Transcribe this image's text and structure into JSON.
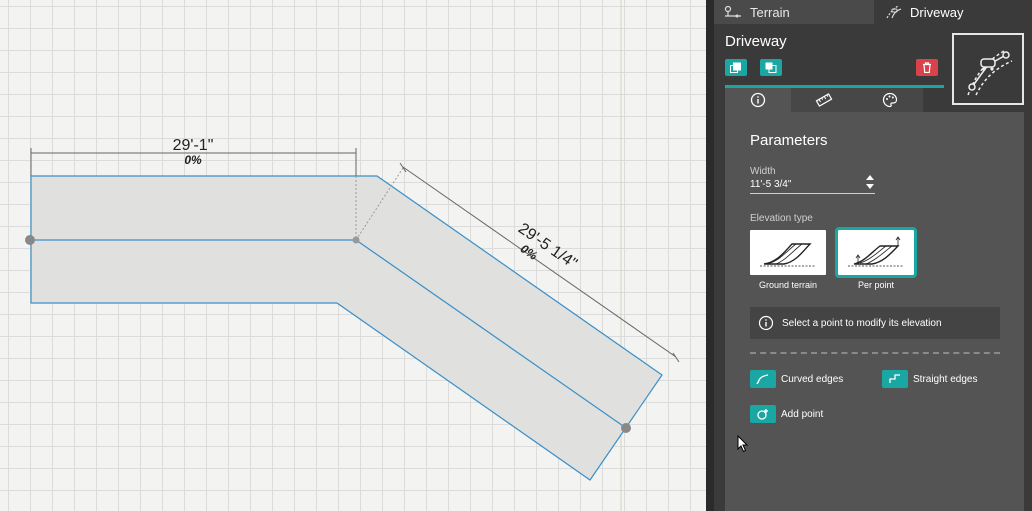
{
  "canvas": {
    "segment1": {
      "length": "29'-1\"",
      "slope": "0%"
    },
    "segment2": {
      "length": "29'-5 1/4\"",
      "slope": "0%"
    }
  },
  "tabs": {
    "terrain": {
      "label": "Terrain",
      "icon": "terrain-icon"
    },
    "driveway": {
      "label": "Driveway",
      "icon": "driveway-icon"
    }
  },
  "panel": {
    "title": "Driveway",
    "buttons": {
      "bring_front": "bring-to-front-icon",
      "send_back": "send-to-back-icon",
      "delete": "trash-icon"
    },
    "preview_icon": "driveway-path-icon",
    "sub_tabs": [
      {
        "name": "info",
        "icon": "info-icon"
      },
      {
        "name": "dimensions",
        "icon": "ruler-icon"
      },
      {
        "name": "style",
        "icon": "palette-icon"
      }
    ],
    "parameters": {
      "title": "Parameters",
      "width_label": "Width",
      "width_value": "11'-5 3/4\"",
      "elevation_label": "Elevation type",
      "elevation_options": [
        {
          "label": "Ground terrain",
          "selected": false
        },
        {
          "label": "Per point",
          "selected": true
        }
      ],
      "info_text": "Select a point to modify its elevation"
    },
    "tools": {
      "curved_edges": "Curved edges",
      "straight_edges": "Straight edges",
      "add_point": "Add point"
    }
  },
  "colors": {
    "accent": "#1aa6a2",
    "danger": "#d9424a",
    "panel_bg": "#3a3a3a",
    "content_bg": "#545454",
    "driveway_fill": "#e0e0df",
    "driveway_edge": "#3b8fc6"
  }
}
